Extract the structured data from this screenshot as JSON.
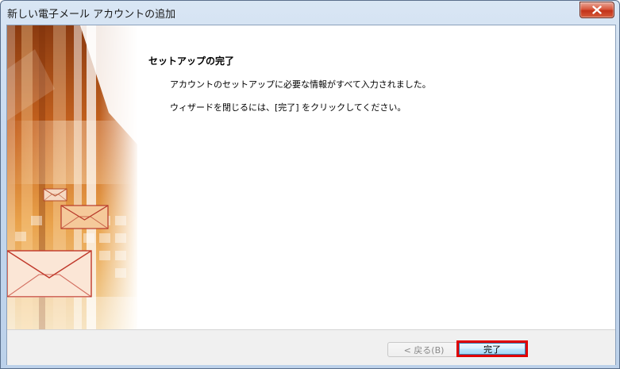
{
  "window": {
    "title": "新しい電子メール アカウントの追加"
  },
  "content": {
    "heading": "セットアップの完了",
    "line1": "アカウントのセットアップに必要な情報がすべて入力されました。",
    "line2": "ウィザードを閉じるには、[完了] をクリックしてください。"
  },
  "buttons": {
    "back_label": "< 戻る(B)",
    "finish_label": "完了"
  },
  "colors": {
    "highlight": "#e00000",
    "banner_orange": "#e08a3a"
  },
  "icons": {
    "close": "close-icon",
    "envelope": "envelope-icon"
  }
}
